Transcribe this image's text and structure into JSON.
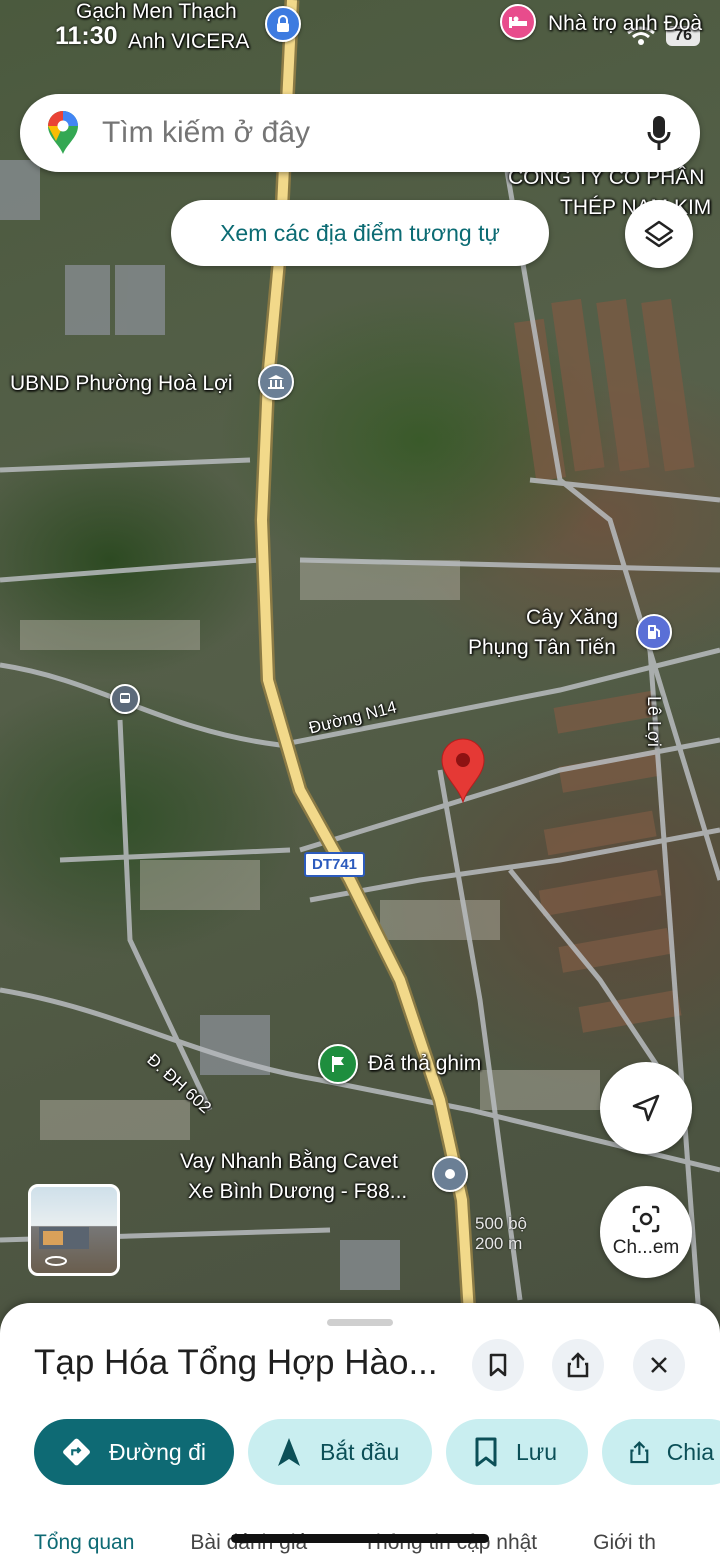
{
  "status_bar": {
    "time": "11:30",
    "battery": "76"
  },
  "search": {
    "placeholder": "Tìm kiếm ở đây"
  },
  "similar_chip": "Xem các địa điểm tương tự",
  "map_labels": {
    "top_left": "Gạch Men Thạch",
    "top_left_2": "Anh VICERA",
    "top_right": "Nhà trọ anh Đoà",
    "company_1": "CÔNG TY CỔ PHẦN",
    "company_2": "THÉP NAM KIM",
    "ubnd": "UBND Phường Hoà Lợi",
    "gas_1": "Cây Xăng",
    "gas_2": "Phụng Tân Tiến",
    "le_loi": "Lê Lợi",
    "duong_n14": "Đường N14",
    "dt741": "DT741",
    "dh602": "Đ. ĐH 602",
    "dropped_pin": "Đã thả ghim",
    "loan_1": "Vay Nhanh Bằng Cavet",
    "loan_2": "Xe Bình Dương - F88...",
    "scale_ft": "500 bộ",
    "scale_m": "200 m"
  },
  "lens_label": "Ch...em",
  "place": {
    "title": "Tạp Hóa Tổng Hợp Hào..."
  },
  "actions": {
    "directions": "Đường đi",
    "start": "Bắt đầu",
    "save": "Lưu",
    "share": "Chia"
  },
  "tabs": [
    "Tổng quan",
    "Bài đánh giá",
    "Thông tin cập nhật",
    "Giới th"
  ],
  "colors": {
    "accent": "#0e6a74",
    "chip_bg": "#c9eef0",
    "pin_red": "#e53935",
    "road": "#f2d98a"
  },
  "icons": [
    "google-maps-pin-icon",
    "mic-icon",
    "layers-icon",
    "navigate-icon",
    "lens-icon",
    "bookmark-icon",
    "share-icon",
    "close-icon",
    "directions-icon",
    "start-arrow-icon"
  ]
}
